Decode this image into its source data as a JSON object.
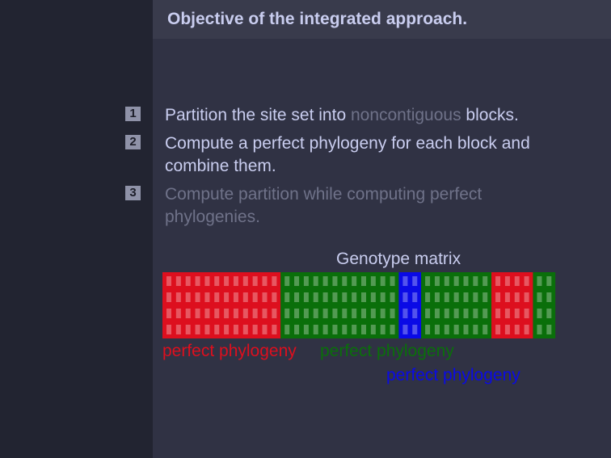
{
  "frame": {
    "title": "Objective of the integrated approach."
  },
  "items": [
    {
      "number": "1",
      "text_before": "Partition the site set into ",
      "text_muted": "noncontiguous",
      "text_after": " blocks."
    },
    {
      "number": "2",
      "text": "Compute a perfect phylogeny for each block and combine them."
    },
    {
      "number": "3",
      "text": "Compute partition while computing perfect phylogenies."
    }
  ],
  "matrix": {
    "title": "Genotype matrix",
    "rows": 4,
    "blocks": [
      {
        "color": "red",
        "columns": 12
      },
      {
        "color": "green",
        "columns": 12
      },
      {
        "color": "blue",
        "columns": 2
      },
      {
        "color": "green",
        "columns": 7
      },
      {
        "color": "red",
        "columns": 4
      },
      {
        "color": "green",
        "columns": 2
      }
    ],
    "colors": {
      "red": "#dd0f1e",
      "green": "#0a6f0a",
      "blue": "#0a0ae6"
    }
  },
  "labels": [
    {
      "text": "perfect phylogeny",
      "color": "#dd0f1e"
    },
    {
      "text": "perfect phylogeny",
      "color": "#0a6f0a"
    },
    {
      "text": "perfect phylogeny",
      "color": "#0a0ae6"
    }
  ]
}
